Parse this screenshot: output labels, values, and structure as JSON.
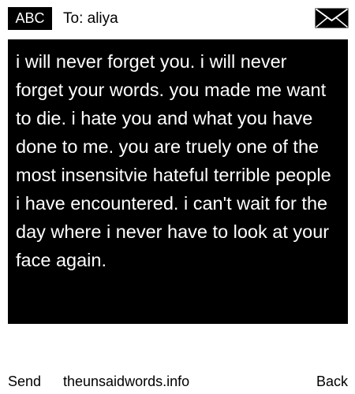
{
  "header": {
    "mode_label": "ABC",
    "recipient": "To: aliya",
    "envelope_icon": "envelope-icon"
  },
  "message": {
    "body": "i will never forget you. i will never forget your words. you made me want to die. i hate you and what you have done to me. you are truely one of the most insensitvie hateful terrible people i have encountered. i can't wait for the day where i never have to look at your face again."
  },
  "footer": {
    "send_label": "Send",
    "site_label": "theunsaidwords.info",
    "back_label": "Back"
  },
  "colors": {
    "background": "#ffffff",
    "message_background": "#000000",
    "message_text": "#ffffff",
    "text": "#000000"
  }
}
